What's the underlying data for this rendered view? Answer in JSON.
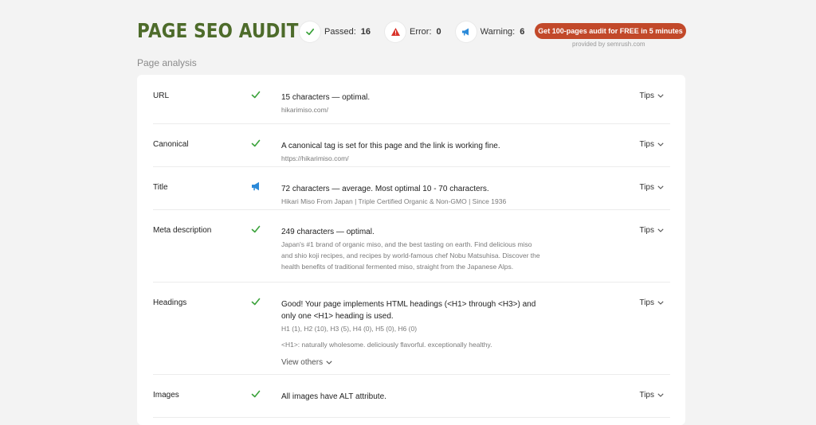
{
  "header": {
    "title": "PAGE SEO AUDIT",
    "stats": [
      {
        "label": "Passed:",
        "value": "16",
        "icon": "check-icon",
        "color": "#3aa23a"
      },
      {
        "label": "Error:",
        "value": "0",
        "icon": "error-triangle-icon",
        "color": "#d9342b"
      },
      {
        "label": "Warning:",
        "value": "6",
        "icon": "megaphone-icon",
        "color": "#2b8ad9"
      }
    ],
    "cta_label": "Get 100-pages audit for FREE in 5 minutes",
    "cta_color": "#c2492a",
    "provided_by": "provided by  semrush.com"
  },
  "section_title": "Page analysis",
  "rows": [
    {
      "label": "URL",
      "status": "passed",
      "main": "15 characters — optimal.",
      "sub": "hikarimiso.com/",
      "tips": "Tips"
    },
    {
      "label": "Canonical",
      "status": "passed",
      "main": "A canonical tag is set for this page and the link is working fine.",
      "sub": "https://hikarimiso.com/",
      "tips": "Tips"
    },
    {
      "label": "Title",
      "status": "warning",
      "main": "72 characters — average. Most optimal 10 - 70 characters.",
      "sub": "Hikari Miso From Japan | Triple Certified Organic & Non-GMO | Since 1936",
      "tips": "Tips"
    },
    {
      "label": "Meta description",
      "status": "passed",
      "main": "249 characters — optimal.",
      "sub": "Japan's #1 brand of organic miso, and the best tasting on earth. Find delicious miso and shio koji recipes, and recipes by world-famous chef Nobu Matsuhisa. Discover the health benefits of traditional fermented miso, straight from the Japanese Alps.",
      "tips": "Tips"
    },
    {
      "label": "Headings",
      "status": "passed",
      "main": "Good! Your page implements HTML headings (<H1> through <H3>) and only one <H1> heading is used.",
      "sub": "H1 (1), H2 (10), H3 (5), H4 (0), H5 (0), H6 (0)",
      "sub2": "<H1>: naturally wholesome. deliciously flavorful. exceptionally healthy.",
      "view_others": "View others",
      "tips": "Tips"
    },
    {
      "label": "Images",
      "status": "passed",
      "main": "All images have ALT attribute.",
      "tips": "Tips"
    }
  ],
  "colors": {
    "title": "#4d6b2a",
    "passed": "#3aa23a",
    "warning": "#2b8ad9",
    "error": "#d9342b"
  }
}
